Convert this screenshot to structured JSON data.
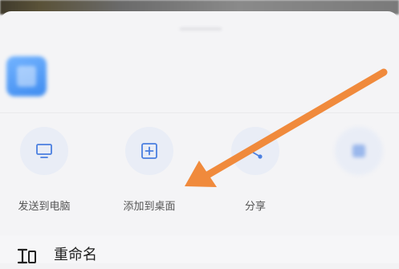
{
  "file": {
    "name": "",
    "meta": ""
  },
  "actions": [
    {
      "label": "发送到电脑",
      "icon": "monitor-icon"
    },
    {
      "label": "添加到桌面",
      "icon": "add-square-icon"
    },
    {
      "label": "分享",
      "icon": "share-icon"
    },
    {
      "label": "",
      "icon": "app-icon"
    }
  ],
  "menu": {
    "rename_label": "重命名",
    "rename_icon": "rename-icon"
  },
  "annotation": {
    "arrow_color": "#f08a3c",
    "arrow_target": "添加到桌面"
  },
  "colors": {
    "accent": "#4a7fe0",
    "icon_circle": "#e9edf6",
    "file_icon": "#4a95f5"
  }
}
